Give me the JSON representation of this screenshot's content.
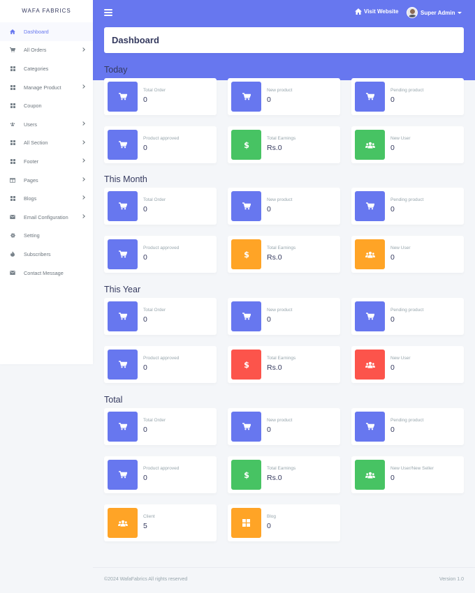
{
  "brand": "WAFA FABRICS",
  "navbar": {
    "visit": "Visit Website",
    "user": "Super Admin"
  },
  "sidebar": [
    {
      "label": "Dashboard",
      "icon": "home-icon",
      "active": true,
      "chevron": false
    },
    {
      "label": "All Orders",
      "icon": "cart-icon",
      "chevron": true
    },
    {
      "label": "Categories",
      "icon": "grid-icon",
      "chevron": false
    },
    {
      "label": "Manage Product",
      "icon": "grid-icon",
      "chevron": true
    },
    {
      "label": "Coupon",
      "icon": "grid-icon",
      "chevron": false
    },
    {
      "label": "Users",
      "icon": "users-icon",
      "chevron": true
    },
    {
      "label": "All Section",
      "icon": "grid-icon",
      "chevron": true
    },
    {
      "label": "Footer",
      "icon": "grid-icon",
      "chevron": true
    },
    {
      "label": "Pages",
      "icon": "columns-icon",
      "chevron": true
    },
    {
      "label": "Blogs",
      "icon": "grid-icon",
      "chevron": true
    },
    {
      "label": "Email Configuration",
      "icon": "envelope-icon",
      "chevron": true
    },
    {
      "label": "Setting",
      "icon": "gear-icon",
      "chevron": false
    },
    {
      "label": "Subscribers",
      "icon": "fire-icon",
      "chevron": false
    },
    {
      "label": "Contact Message",
      "icon": "envelope-icon",
      "chevron": false
    }
  ],
  "page_title": "Dashboard",
  "colors": {
    "blue": "#6777ef",
    "green": "#47c363",
    "orange": "#ffa426",
    "red": "#fc544b"
  },
  "sections": [
    {
      "title": "Today",
      "cards": [
        {
          "label": "Total Order",
          "value": "0",
          "icon": "cart-icon",
          "color": "blue"
        },
        {
          "label": "New product",
          "value": "0",
          "icon": "cart-icon",
          "color": "blue"
        },
        {
          "label": "Pending product",
          "value": "0",
          "icon": "cart-icon",
          "color": "blue"
        },
        {
          "label": "Product approved",
          "value": "0",
          "icon": "cart-icon",
          "color": "blue"
        },
        {
          "label": "Total Earnings",
          "value": "Rs.0",
          "icon": "dollar-icon",
          "color": "green"
        },
        {
          "label": "New User",
          "value": "0",
          "icon": "users-icon",
          "color": "green"
        }
      ]
    },
    {
      "title": "This Month",
      "cards": [
        {
          "label": "Total Order",
          "value": "0",
          "icon": "cart-icon",
          "color": "blue"
        },
        {
          "label": "New product",
          "value": "0",
          "icon": "cart-icon",
          "color": "blue"
        },
        {
          "label": "Pending product",
          "value": "0",
          "icon": "cart-icon",
          "color": "blue"
        },
        {
          "label": "Product approved",
          "value": "0",
          "icon": "cart-icon",
          "color": "blue"
        },
        {
          "label": "Total Earnings",
          "value": "Rs.0",
          "icon": "dollar-icon",
          "color": "orange"
        },
        {
          "label": "New User",
          "value": "0",
          "icon": "users-icon",
          "color": "orange"
        }
      ]
    },
    {
      "title": "This Year",
      "cards": [
        {
          "label": "Total Order",
          "value": "0",
          "icon": "cart-icon",
          "color": "blue"
        },
        {
          "label": "New product",
          "value": "0",
          "icon": "cart-icon",
          "color": "blue"
        },
        {
          "label": "Pending product",
          "value": "0",
          "icon": "cart-icon",
          "color": "blue"
        },
        {
          "label": "Product approved",
          "value": "0",
          "icon": "cart-icon",
          "color": "blue"
        },
        {
          "label": "Total Earnings",
          "value": "Rs.0",
          "icon": "dollar-icon",
          "color": "red"
        },
        {
          "label": "New User",
          "value": "0",
          "icon": "users-icon",
          "color": "red"
        }
      ]
    },
    {
      "title": "Total",
      "cards": [
        {
          "label": "Total Order",
          "value": "0",
          "icon": "cart-icon",
          "color": "blue"
        },
        {
          "label": "New product",
          "value": "0",
          "icon": "cart-icon",
          "color": "blue"
        },
        {
          "label": "Pending product",
          "value": "0",
          "icon": "cart-icon",
          "color": "blue"
        },
        {
          "label": "Product approved",
          "value": "0",
          "icon": "cart-icon",
          "color": "blue"
        },
        {
          "label": "Total Earnings",
          "value": "Rs.0",
          "icon": "dollar-icon",
          "color": "green"
        },
        {
          "label": "New User/New Seller",
          "value": "0",
          "icon": "users-icon",
          "color": "green"
        },
        {
          "label": "Client",
          "value": "5",
          "icon": "users-icon",
          "color": "orange"
        },
        {
          "label": "Blog",
          "value": "0",
          "icon": "grid-icon",
          "color": "orange"
        }
      ]
    }
  ],
  "footer": {
    "copyright": "©2024 WafaFabrics All rights reserved",
    "version": "Version 1.0"
  }
}
